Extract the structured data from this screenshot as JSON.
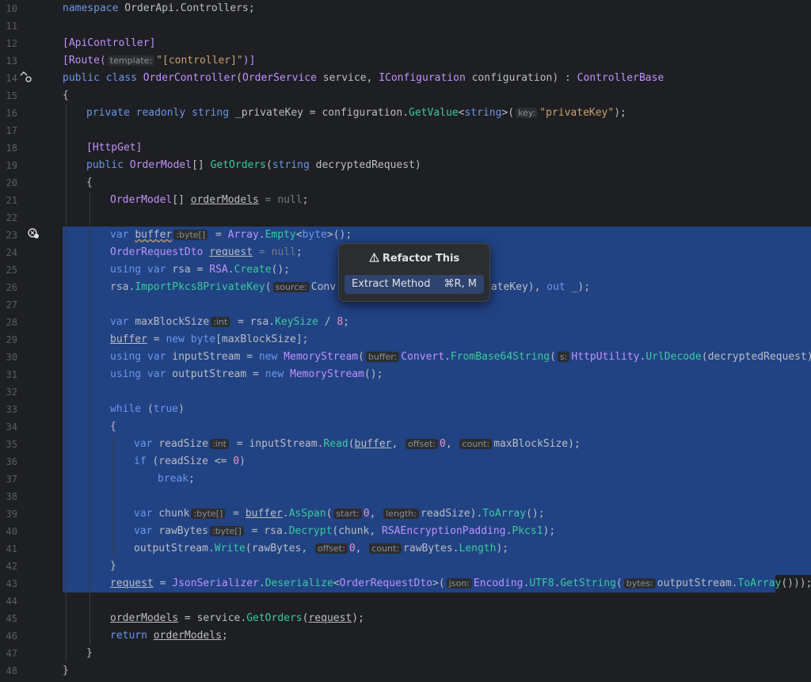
{
  "gutter": {
    "line_numbers": [
      "10",
      "11",
      "12",
      "13",
      "14",
      "15",
      "16",
      "17",
      "18",
      "19",
      "20",
      "21",
      "22",
      "23",
      "24",
      "25",
      "26",
      "27",
      "28",
      "29",
      "30",
      "31",
      "32",
      "33",
      "34",
      "35",
      "36",
      "37",
      "38",
      "39",
      "40",
      "41",
      "42",
      "43",
      "44",
      "45",
      "46",
      "47",
      "48"
    ]
  },
  "code": {
    "l10": [
      "namespace",
      "OrderApi.Controllers;"
    ],
    "l12": "[ApiController]",
    "l13": {
      "a": "[Route(",
      "hint": "template:",
      "b": "\"[controller]\"",
      "c": ")]"
    },
    "l14": [
      "public",
      "class",
      "OrderController",
      "(",
      "OrderService",
      "service",
      ",",
      "IConfiguration",
      "configuration",
      ") :",
      "ControllerBase"
    ],
    "l15": "{",
    "l16": {
      "a": "private",
      "b": "readonly",
      "c": "string",
      "d": "_privateKey = configuration.",
      "e": "GetValue",
      "f": "<",
      "g": "string",
      "h": ">(",
      "hint": "key:",
      "i": "\"privateKey\"",
      "j": ");"
    },
    "l18": "[HttpGet]",
    "l19": {
      "a": "public",
      "b": "OrderModel",
      "c": "[]",
      "d": "GetOrders",
      "e": "(",
      "f": "string",
      "g": "decryptedRequest)"
    },
    "l20": "{",
    "l21": {
      "a": "OrderModel",
      "b": "[] ",
      "c": "orderModels",
      "d": " = ",
      "e": "null",
      "f": ";"
    },
    "l23": {
      "a": "var",
      "b": "buffer",
      "hint": ":byte[]",
      "c": " = ",
      "d": "Array",
      "e": ".",
      "f": "Empty",
      "g": "<",
      "h": "byte",
      "i": ">();"
    },
    "l24": {
      "a": "OrderRequestDto",
      "b": "request",
      "c": " = ",
      "d": "null",
      "e": ";"
    },
    "l25": {
      "a": "using",
      "b": "var",
      "c": "rsa = ",
      "d": "RSA",
      "e": ".",
      "f": "Create",
      "g": "();"
    },
    "l26": {
      "a": "rsa.",
      "b": "ImportPkcs8PrivateKey",
      "c": "(",
      "hint": "source:",
      "d": "Conv",
      "e": "rateKey), ",
      "f": "out",
      "g": " _);"
    },
    "l28": {
      "a": "var",
      "b": "maxBlockSize",
      "hint": ":int",
      "c": " = rsa.",
      "d": "KeySize",
      "e": " / ",
      "f": "8",
      "g": ";"
    },
    "l29": {
      "a": "buffer",
      "b": " = ",
      "c": "new",
      "d": "byte",
      "e": "[maxBlockSize];"
    },
    "l30": {
      "a": "using",
      "b": "var",
      "c": "inputStream = ",
      "d": "new",
      "e": "MemoryStream",
      "f": "(",
      "hint1": "buffer:",
      "g": "Convert",
      "h": ".",
      "i": "FromBase64String",
      "j": "(",
      "hint2": "s:",
      "k": "HttpUtility",
      "l": ".",
      "m": "UrlDecode",
      "n": "(decryptedRequest)));"
    },
    "l31": {
      "a": "using",
      "b": "var",
      "c": "outputStream = ",
      "d": "new",
      "e": "MemoryStream",
      "f": "();"
    },
    "l33": {
      "a": "while",
      "b": " (",
      "c": "true",
      "d": ")"
    },
    "l34": "{",
    "l35": {
      "a": "var",
      "b": "readSize",
      "hint1": ":int",
      "c": " = inputStream.",
      "d": "Read",
      "e": "(",
      "f": "buffer",
      "g": ", ",
      "hint2": "offset:",
      "h": "0",
      "i": ", ",
      "hint3": "count:",
      "j": "maxBlockSize);"
    },
    "l36": {
      "a": "if",
      "b": " (readSize <= ",
      "c": "0",
      "d": ")"
    },
    "l37": {
      "a": "break",
      "b": ";"
    },
    "l39": {
      "a": "var",
      "b": "chunk",
      "hint1": ":byte[]",
      "c": " = ",
      "d": "buffer",
      "e": ".",
      "f": "AsSpan",
      "g": "(",
      "hint2": "start:",
      "h": "0",
      "i": ", ",
      "hint3": "length:",
      "j": "readSize).",
      "k": "ToArray",
      "l": "();"
    },
    "l40": {
      "a": "var",
      "b": "rawBytes",
      "hint": ":byte[]",
      "c": " = rsa.",
      "d": "Decrypt",
      "e": "(chunk, ",
      "f": "RSAEncryptionPadding",
      "g": ".",
      "h": "Pkcs1",
      "i": ");"
    },
    "l41": {
      "a": "outputStream.",
      "b": "Write",
      "c": "(rawBytes, ",
      "hint1": "offset:",
      "d": "0",
      "e": ", ",
      "hint2": "count:",
      "f": "rawBytes.",
      "g": "Length",
      "h": ");"
    },
    "l42": "}",
    "l43": {
      "a": "request",
      "b": " = ",
      "c": "JsonSerializer",
      "d": ".",
      "e": "Deserialize",
      "f": "<",
      "g": "OrderRequestDto",
      "h": ">(",
      "hint1": "json:",
      "i": "Encoding",
      "j": ".",
      "k": "UTF8",
      "l": ".",
      "m": "GetString",
      "n": "(",
      "hint2": "bytes:",
      "o": "outputStream.",
      "p": "ToArray",
      "q": "()));"
    },
    "l45": {
      "a": "orderModels",
      "b": " = service.",
      "c": "GetOrders",
      "d": "(",
      "e": "request",
      "f": ");"
    },
    "l46": {
      "a": "return",
      "b": "orderModels",
      "c": ";"
    },
    "l47": "}",
    "l48": "}"
  },
  "popup": {
    "title": "Refactor This",
    "item_label": "Extract Method",
    "item_shortcut": "⌘R, M"
  },
  "colors": {
    "background": "#1e1f22",
    "selection": "#214283",
    "keyword": "#6c95eb",
    "type": "#c191ff",
    "method": "#39cc9b",
    "string": "#c9a26d",
    "number": "#ed94c0"
  }
}
